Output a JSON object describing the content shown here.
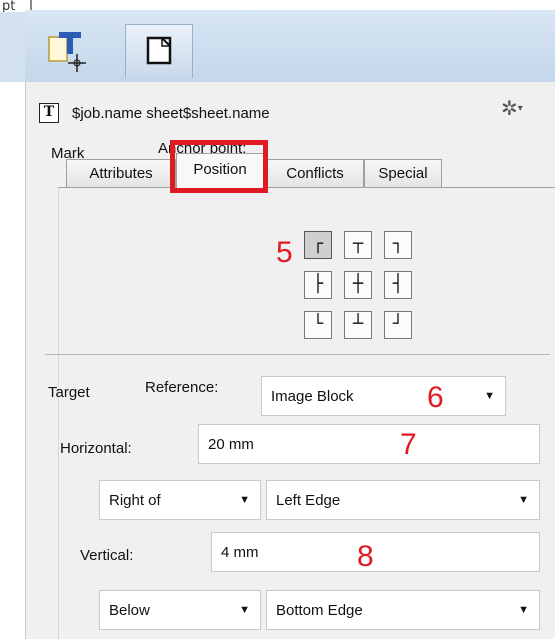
{
  "top": {
    "pt_label": "pt",
    "tools": [
      {
        "name": "text-marker-tool",
        "icon": "text-marker-icon"
      },
      {
        "name": "page-tool",
        "icon": "page-icon"
      }
    ]
  },
  "panel": {
    "title": "$job.name sheet$sheet.name",
    "title_icon_glyph": "T",
    "gear_glyph": "✲",
    "gear_arrow": "▾",
    "tabs": [
      {
        "label": "Attributes",
        "active": false
      },
      {
        "label": "Position",
        "active": true
      },
      {
        "label": "Conflicts",
        "active": false
      },
      {
        "label": "Special",
        "active": false
      }
    ]
  },
  "mark": {
    "label": "Mark",
    "anchor_label": "Anchor point:",
    "anchors": [
      {
        "glyph": "┌",
        "selected": true
      },
      {
        "glyph": "┬",
        "selected": false
      },
      {
        "glyph": "┐",
        "selected": false
      },
      {
        "glyph": "├",
        "selected": false
      },
      {
        "glyph": "┼",
        "selected": false
      },
      {
        "glyph": "┤",
        "selected": false
      },
      {
        "glyph": "└",
        "selected": false
      },
      {
        "glyph": "┴",
        "selected": false
      },
      {
        "glyph": "┘",
        "selected": false
      }
    ]
  },
  "target": {
    "label": "Target",
    "reference_label": "Reference:",
    "reference_value": "Image Block",
    "horizontal_label": "Horizontal:",
    "horizontal_value": "20 mm",
    "horizontal_relation": "Right of",
    "horizontal_edge": "Left Edge",
    "vertical_label": "Vertical:",
    "vertical_value": "4 mm",
    "vertical_relation": "Below",
    "vertical_edge": "Bottom Edge"
  },
  "annotations": {
    "a5": "5",
    "a6": "6",
    "a7": "7",
    "a8": "8"
  },
  "colors": {
    "highlight": "#e01a22",
    "toolbar": "#c9daec",
    "panel": "#f0f0f0"
  }
}
